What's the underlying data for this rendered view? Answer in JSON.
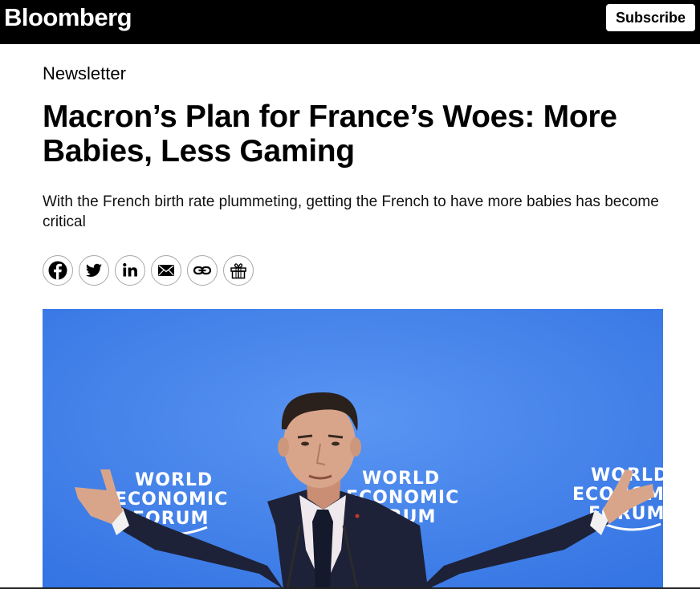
{
  "header": {
    "logo": "Bloomberg",
    "subscribe_label": "Subscribe"
  },
  "article": {
    "kicker": "Newsletter",
    "headline": "Macron’s Plan for France’s Woes: More Babies, Less Gaming",
    "dek": "With the French birth rate plummeting, getting the French to have more babies has become critical"
  },
  "share": {
    "icons": [
      "facebook-icon",
      "twitter-icon",
      "linkedin-icon",
      "email-icon",
      "link-icon",
      "gift-icon"
    ]
  },
  "hero_image": {
    "backdrop_text": {
      "left": [
        "WORLD",
        "ECONOMIC",
        "FORUM"
      ],
      "center": [
        "WORLD",
        "ECONOMIC",
        "FORUM"
      ],
      "right": [
        "WORLD",
        "ECONOMIC",
        "FORUM"
      ]
    },
    "colors": {
      "backdrop": "#3f7fe8",
      "suit": "#1d2238",
      "skin": "#d9a58a"
    }
  }
}
